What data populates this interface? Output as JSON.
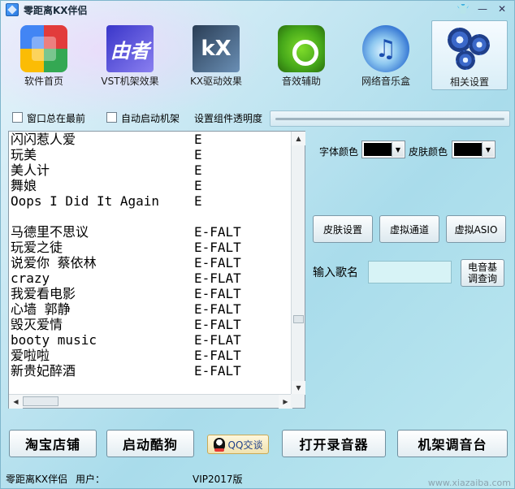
{
  "window": {
    "title": "零距离KX伴侣",
    "controls": [
      "shirt-icon",
      "minimize-icon",
      "close-icon"
    ]
  },
  "toolbar": {
    "items": [
      {
        "label": "软件首页",
        "icon": "home-icon"
      },
      {
        "label": "VST机架效果",
        "icon": "vst-icon",
        "icon_text": "由者"
      },
      {
        "label": "KX驱动效果",
        "icon": "kx-icon",
        "icon_text": "kX"
      },
      {
        "label": "音效辅助",
        "icon": "sound-fx-icon"
      },
      {
        "label": "网络音乐盒",
        "icon": "music-note-icon"
      },
      {
        "label": "相关设置",
        "icon": "gear-icon",
        "selected": true
      }
    ]
  },
  "options": {
    "always_on_top": {
      "label": "窗口总在最前",
      "checked": false
    },
    "auto_start_rack": {
      "label": "自动启动机架",
      "checked": false
    },
    "opacity_label": "设置组件透明度"
  },
  "songs": [
    {
      "name": "闪闪惹人爱",
      "tag": "E"
    },
    {
      "name": "玩美",
      "tag": "E"
    },
    {
      "name": "美人计",
      "tag": "E"
    },
    {
      "name": "舞娘",
      "tag": "E"
    },
    {
      "name": "Oops I Did It Again",
      "tag": "E"
    },
    {
      "name": "",
      "tag": ""
    },
    {
      "name": "马德里不思议",
      "tag": "E-FALT"
    },
    {
      "name": "玩爱之徒",
      "tag": "E-FALT"
    },
    {
      "name": "说爱你  蔡依林",
      "tag": "E-FALT"
    },
    {
      "name": "crazy",
      "tag": "E-FLAT"
    },
    {
      "name": "我爱看电影",
      "tag": "E-FALT"
    },
    {
      "name": "心墙 郭静",
      "tag": "E-FALT"
    },
    {
      "name": "毁灭爱情",
      "tag": "E-FALT"
    },
    {
      "name": "booty music",
      "tag": "E-FLAT"
    },
    {
      "name": "爱啦啦",
      "tag": "E-FALT"
    },
    {
      "name": "新贵妃醉酒",
      "tag": "E-FALT"
    }
  ],
  "right_panel": {
    "font_color_label": "字体颜色",
    "skin_color_label": "皮肤颜色",
    "font_color": "#000000",
    "skin_color": "#000000",
    "skin_settings": "皮肤设置",
    "virtual_channel": "虚拟通道",
    "virtual_asio": "虚拟ASIO",
    "song_name_label": "输入歌名",
    "song_name_value": "",
    "lookup_button": "电音基调查询"
  },
  "bottom": {
    "taobao": "淘宝店铺",
    "kugou": "启动酷狗",
    "qq": "QQ交谈",
    "recorder": "打开录音器",
    "mixer": "机架调音台"
  },
  "status": {
    "app_name": "零距离KX伴侣",
    "user_label": "用户：",
    "version": "VIP2017版"
  },
  "watermark": "www.xiazaiba.com",
  "colors": {
    "accent": "#8cb9cc",
    "background": "#bfe3ee"
  }
}
